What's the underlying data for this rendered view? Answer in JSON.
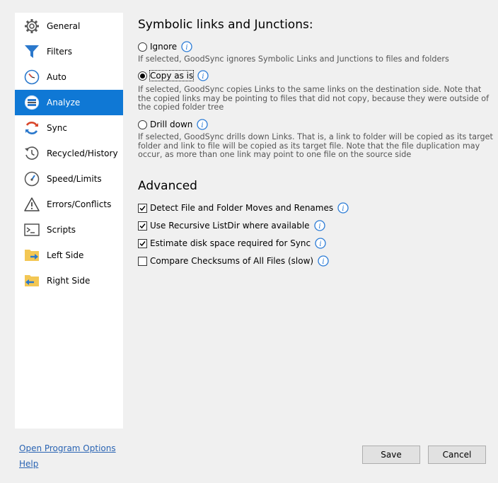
{
  "sidebar": {
    "items": [
      {
        "label": "General",
        "icon": "gear-icon"
      },
      {
        "label": "Filters",
        "icon": "funnel-icon"
      },
      {
        "label": "Auto",
        "icon": "clock-icon"
      },
      {
        "label": "Analyze",
        "icon": "analyze-icon",
        "active": true
      },
      {
        "label": "Sync",
        "icon": "sync-icon"
      },
      {
        "label": "Recycled/History",
        "icon": "history-icon"
      },
      {
        "label": "Speed/Limits",
        "icon": "gauge-icon"
      },
      {
        "label": "Errors/Conflicts",
        "icon": "warning-icon"
      },
      {
        "label": "Scripts",
        "icon": "terminal-icon"
      },
      {
        "label": "Left Side",
        "icon": "folder-right-icon"
      },
      {
        "label": "Right Side",
        "icon": "folder-left-icon"
      }
    ]
  },
  "symlinks": {
    "title": "Symbolic links and Junctions:",
    "options": [
      {
        "label": "Ignore",
        "selected": false,
        "desc": "If selected, GoodSync ignores Symbolic Links and Junctions to files and folders"
      },
      {
        "label": "Copy as is",
        "selected": true,
        "desc": "If selected, GoodSync copies Links to the same links on the destination side. Note that the copied links may be pointing to files that did not copy, because they were outside of the copied folder tree"
      },
      {
        "label": "Drill down",
        "selected": false,
        "desc": "If selected, GoodSync drills down Links. That is, a link to folder will be copied as its target folder and link to file will be copied as its target file. Note that the file duplication may occur, as more than one link may point to one file on the source side"
      }
    ]
  },
  "advanced": {
    "title": "Advanced",
    "options": [
      {
        "label": "Detect File and Folder Moves and Renames",
        "checked": true
      },
      {
        "label": "Use Recursive ListDir where available",
        "checked": true
      },
      {
        "label": "Estimate disk space required for Sync",
        "checked": true
      },
      {
        "label": "Compare Checksums of All Files (slow)",
        "checked": false
      }
    ]
  },
  "footer": {
    "open_options": "Open Program Options",
    "help": "Help",
    "save": "Save",
    "cancel": "Cancel"
  },
  "colors": {
    "accent": "#0f78d5",
    "link": "#2a64b3",
    "info": "#2a7bd6"
  }
}
